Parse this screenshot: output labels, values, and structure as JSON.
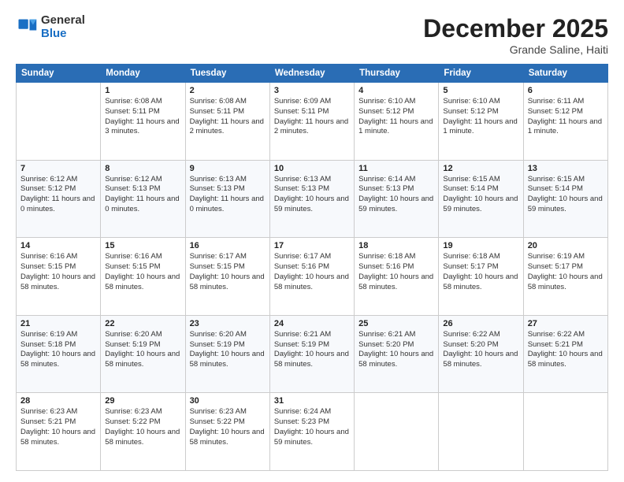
{
  "logo": {
    "general": "General",
    "blue": "Blue"
  },
  "title": {
    "month_year": "December 2025",
    "location": "Grande Saline, Haiti"
  },
  "calendar": {
    "headers": [
      "Sunday",
      "Monday",
      "Tuesday",
      "Wednesday",
      "Thursday",
      "Friday",
      "Saturday"
    ],
    "weeks": [
      [
        {
          "num": "",
          "detail": ""
        },
        {
          "num": "1",
          "detail": "Sunrise: 6:08 AM\nSunset: 5:11 PM\nDaylight: 11 hours\nand 3 minutes."
        },
        {
          "num": "2",
          "detail": "Sunrise: 6:08 AM\nSunset: 5:11 PM\nDaylight: 11 hours\nand 2 minutes."
        },
        {
          "num": "3",
          "detail": "Sunrise: 6:09 AM\nSunset: 5:11 PM\nDaylight: 11 hours\nand 2 minutes."
        },
        {
          "num": "4",
          "detail": "Sunrise: 6:10 AM\nSunset: 5:12 PM\nDaylight: 11 hours\nand 1 minute."
        },
        {
          "num": "5",
          "detail": "Sunrise: 6:10 AM\nSunset: 5:12 PM\nDaylight: 11 hours\nand 1 minute."
        },
        {
          "num": "6",
          "detail": "Sunrise: 6:11 AM\nSunset: 5:12 PM\nDaylight: 11 hours\nand 1 minute."
        }
      ],
      [
        {
          "num": "7",
          "detail": "Sunrise: 6:12 AM\nSunset: 5:12 PM\nDaylight: 11 hours\nand 0 minutes."
        },
        {
          "num": "8",
          "detail": "Sunrise: 6:12 AM\nSunset: 5:13 PM\nDaylight: 11 hours\nand 0 minutes."
        },
        {
          "num": "9",
          "detail": "Sunrise: 6:13 AM\nSunset: 5:13 PM\nDaylight: 11 hours\nand 0 minutes."
        },
        {
          "num": "10",
          "detail": "Sunrise: 6:13 AM\nSunset: 5:13 PM\nDaylight: 10 hours\nand 59 minutes."
        },
        {
          "num": "11",
          "detail": "Sunrise: 6:14 AM\nSunset: 5:13 PM\nDaylight: 10 hours\nand 59 minutes."
        },
        {
          "num": "12",
          "detail": "Sunrise: 6:15 AM\nSunset: 5:14 PM\nDaylight: 10 hours\nand 59 minutes."
        },
        {
          "num": "13",
          "detail": "Sunrise: 6:15 AM\nSunset: 5:14 PM\nDaylight: 10 hours\nand 59 minutes."
        }
      ],
      [
        {
          "num": "14",
          "detail": "Sunrise: 6:16 AM\nSunset: 5:15 PM\nDaylight: 10 hours\nand 58 minutes."
        },
        {
          "num": "15",
          "detail": "Sunrise: 6:16 AM\nSunset: 5:15 PM\nDaylight: 10 hours\nand 58 minutes."
        },
        {
          "num": "16",
          "detail": "Sunrise: 6:17 AM\nSunset: 5:15 PM\nDaylight: 10 hours\nand 58 minutes."
        },
        {
          "num": "17",
          "detail": "Sunrise: 6:17 AM\nSunset: 5:16 PM\nDaylight: 10 hours\nand 58 minutes."
        },
        {
          "num": "18",
          "detail": "Sunrise: 6:18 AM\nSunset: 5:16 PM\nDaylight: 10 hours\nand 58 minutes."
        },
        {
          "num": "19",
          "detail": "Sunrise: 6:18 AM\nSunset: 5:17 PM\nDaylight: 10 hours\nand 58 minutes."
        },
        {
          "num": "20",
          "detail": "Sunrise: 6:19 AM\nSunset: 5:17 PM\nDaylight: 10 hours\nand 58 minutes."
        }
      ],
      [
        {
          "num": "21",
          "detail": "Sunrise: 6:19 AM\nSunset: 5:18 PM\nDaylight: 10 hours\nand 58 minutes."
        },
        {
          "num": "22",
          "detail": "Sunrise: 6:20 AM\nSunset: 5:19 PM\nDaylight: 10 hours\nand 58 minutes."
        },
        {
          "num": "23",
          "detail": "Sunrise: 6:20 AM\nSunset: 5:19 PM\nDaylight: 10 hours\nand 58 minutes."
        },
        {
          "num": "24",
          "detail": "Sunrise: 6:21 AM\nSunset: 5:19 PM\nDaylight: 10 hours\nand 58 minutes."
        },
        {
          "num": "25",
          "detail": "Sunrise: 6:21 AM\nSunset: 5:20 PM\nDaylight: 10 hours\nand 58 minutes."
        },
        {
          "num": "26",
          "detail": "Sunrise: 6:22 AM\nSunset: 5:20 PM\nDaylight: 10 hours\nand 58 minutes."
        },
        {
          "num": "27",
          "detail": "Sunrise: 6:22 AM\nSunset: 5:21 PM\nDaylight: 10 hours\nand 58 minutes."
        }
      ],
      [
        {
          "num": "28",
          "detail": "Sunrise: 6:23 AM\nSunset: 5:21 PM\nDaylight: 10 hours\nand 58 minutes."
        },
        {
          "num": "29",
          "detail": "Sunrise: 6:23 AM\nSunset: 5:22 PM\nDaylight: 10 hours\nand 58 minutes."
        },
        {
          "num": "30",
          "detail": "Sunrise: 6:23 AM\nSunset: 5:22 PM\nDaylight: 10 hours\nand 58 minutes."
        },
        {
          "num": "31",
          "detail": "Sunrise: 6:24 AM\nSunset: 5:23 PM\nDaylight: 10 hours\nand 59 minutes."
        },
        {
          "num": "",
          "detail": ""
        },
        {
          "num": "",
          "detail": ""
        },
        {
          "num": "",
          "detail": ""
        }
      ]
    ]
  }
}
